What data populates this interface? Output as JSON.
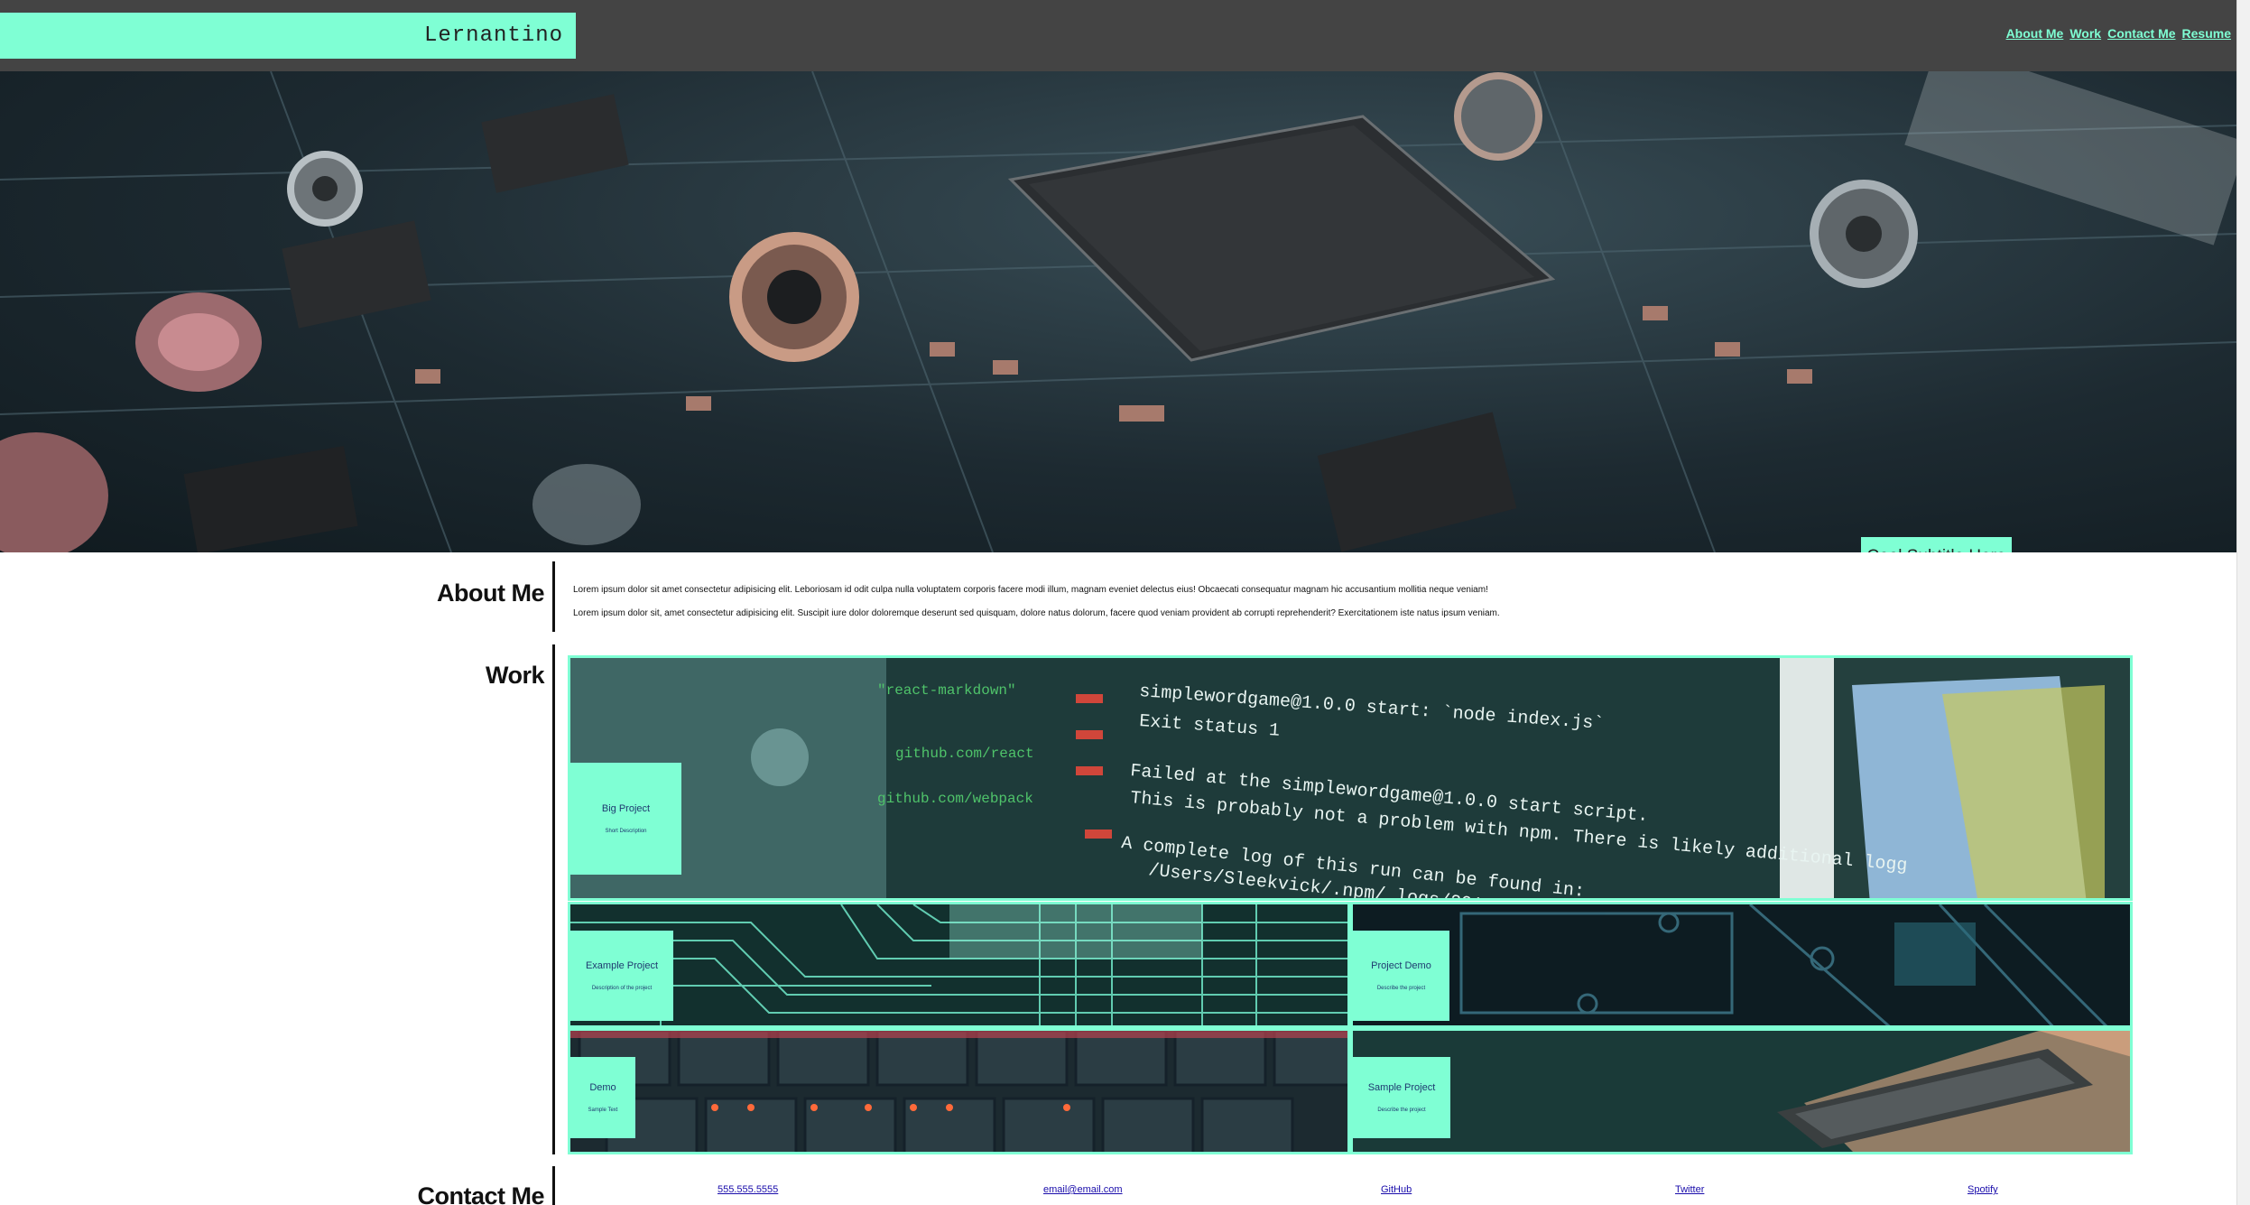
{
  "header": {
    "brand": "Lernantino",
    "nav": [
      "About Me",
      "Work",
      "Contact Me",
      "Resume"
    ]
  },
  "hero": {
    "subtitle": "Cool Subtitle Here"
  },
  "about": {
    "title": "About Me",
    "paragraphs": [
      "Lorem ipsum dolor sit amet consectetur adipisicing elit. Leboriosam id odit culpa nulla voluptatem corporis facere modi illum, magnam eveniet delectus eius! Obcaecati consequatur magnam hic accusantium mollitia neque veniam!",
      "Lorem ipsum dolor sit, amet consectetur adipisicing elit. Suscipit iure dolor doloremque deserunt sed quisquam, dolore natus dolorum, facere quod veniam provident ab corrupti reprehenderit? Exercitationem iste natus ipsum veniam."
    ]
  },
  "work": {
    "title": "Work",
    "projects": [
      {
        "title": "Big Project",
        "description": "Short Description"
      },
      {
        "title": "Example Project",
        "description": "Description of the project"
      },
      {
        "title": "Project Demo",
        "description": "Describe the project"
      },
      {
        "title": "Demo",
        "description": "Sample Text"
      },
      {
        "title": "Sample Project",
        "description": "Describe the project"
      }
    ]
  },
  "contact": {
    "title": "Contact Me",
    "links": [
      "555.555.5555",
      "email@email.com",
      "GitHub",
      "Twitter",
      "Spotify"
    ]
  },
  "colors": {
    "accent": "#7fffd4",
    "header_bg": "#444444",
    "text": "#111111"
  }
}
